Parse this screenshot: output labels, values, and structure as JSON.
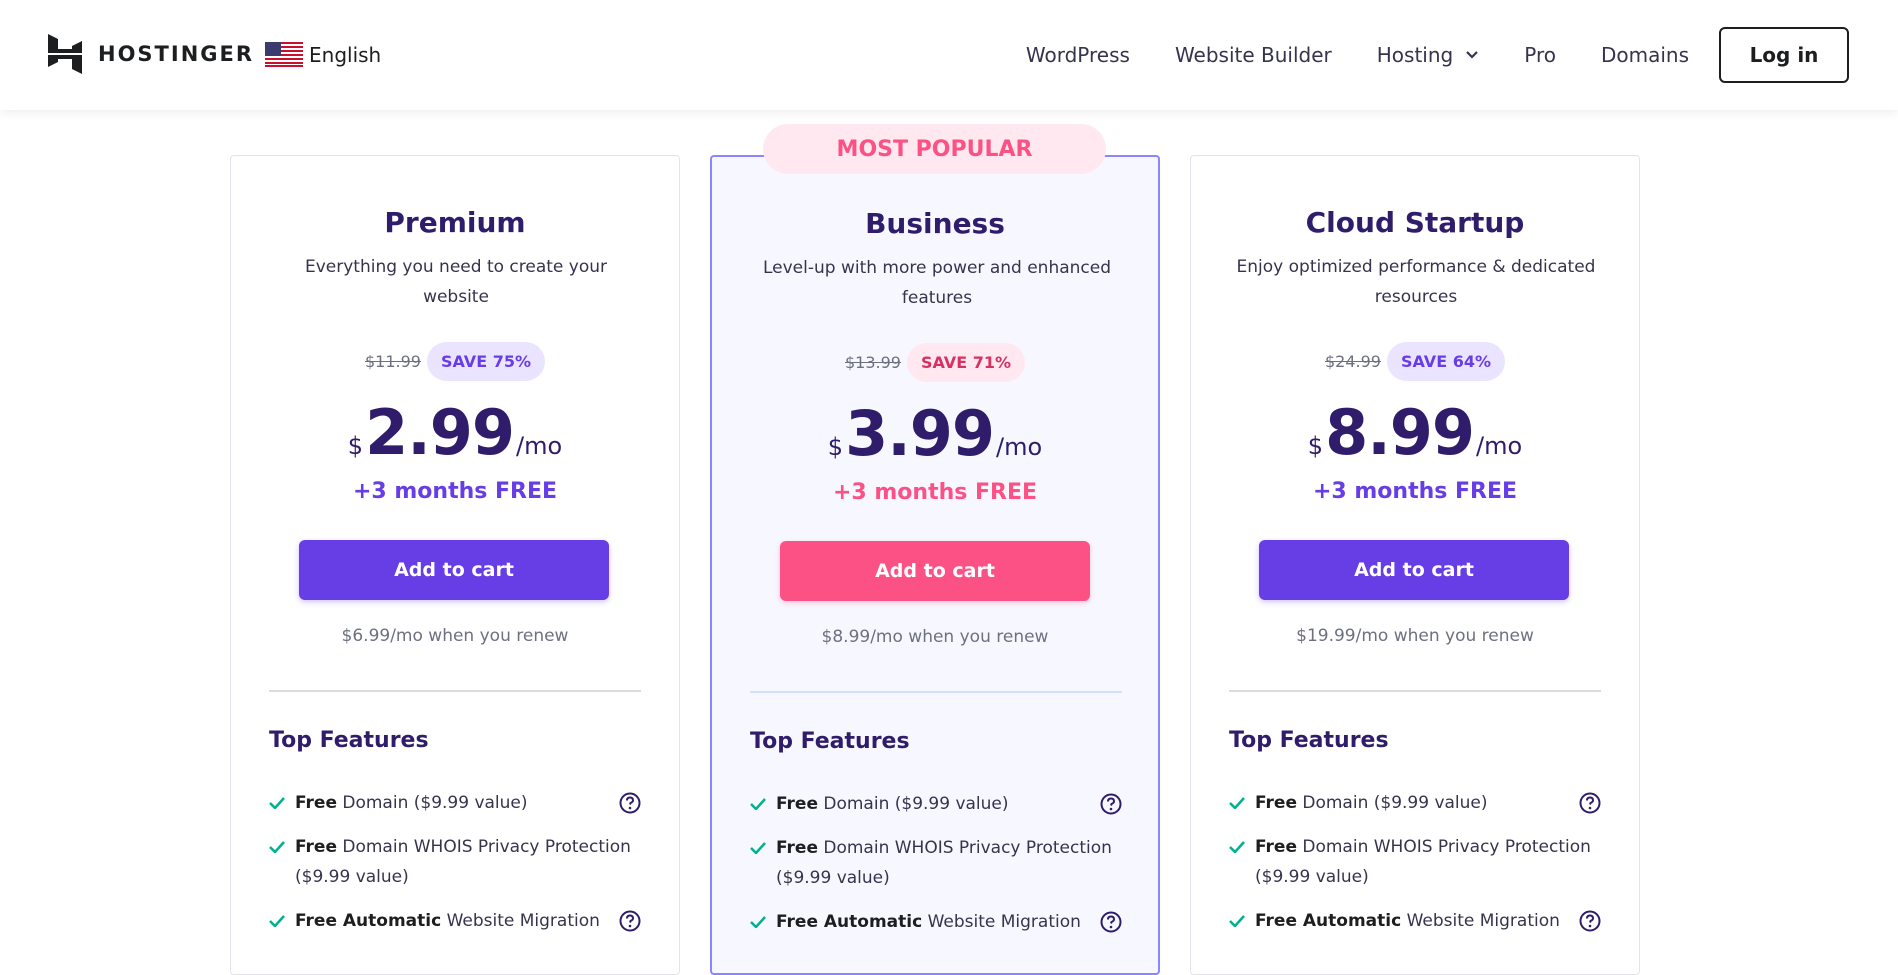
{
  "nav": {
    "brand": "HOSTINGER",
    "language": "English",
    "links": [
      "WordPress",
      "Website Builder",
      "Hosting",
      "Pro",
      "Domains"
    ],
    "login": "Log in"
  },
  "popular_badge": "MOST POPULAR",
  "plans": [
    {
      "name": "Premium",
      "description": "Everything you need to create your website",
      "old_price": "$11.99",
      "save": "SAVE 75%",
      "currency": "$",
      "price": "2.99",
      "period": "/mo",
      "bonus": "+3 months FREE",
      "cta": "Add to cart",
      "renew": "$6.99/mo when you renew",
      "features_title": "Top Features",
      "features": [
        {
          "bold": "Free",
          "text": " Domain ($9.99 value)"
        },
        {
          "bold": "Free",
          "text": " Domain WHOIS Privacy Protection ($9.99 value)"
        },
        {
          "bold": "Free Automatic",
          "text": " Website Migration"
        }
      ]
    },
    {
      "name": "Business",
      "description": "Level-up with more power and enhanced features",
      "old_price": "$13.99",
      "save": "SAVE 71%",
      "currency": "$",
      "price": "3.99",
      "period": "/mo",
      "bonus": "+3 months FREE",
      "cta": "Add to cart",
      "renew": "$8.99/mo when you renew",
      "features_title": "Top Features",
      "features": [
        {
          "bold": "Free",
          "text": " Domain ($9.99 value)"
        },
        {
          "bold": "Free",
          "text": " Domain WHOIS Privacy Protection ($9.99 value)"
        },
        {
          "bold": "Free Automatic",
          "text": " Website Migration"
        }
      ]
    },
    {
      "name": "Cloud Startup",
      "description": "Enjoy optimized performance & dedicated resources",
      "old_price": "$24.99",
      "save": "SAVE 64%",
      "currency": "$",
      "price": "8.99",
      "period": "/mo",
      "bonus": "+3 months FREE",
      "cta": "Add to cart",
      "renew": "$19.99/mo when you renew",
      "features_title": "Top Features",
      "features": [
        {
          "bold": "Free",
          "text": " Domain ($9.99 value)"
        },
        {
          "bold": "Free",
          "text": " Domain WHOIS Privacy Protection ($9.99 value)"
        },
        {
          "bold": "Free Automatic",
          "text": " Website Migration"
        }
      ]
    }
  ],
  "colors": {
    "primary": "#673de6",
    "accent_pink": "#fc5185",
    "text_dark": "#2f1c6a"
  }
}
